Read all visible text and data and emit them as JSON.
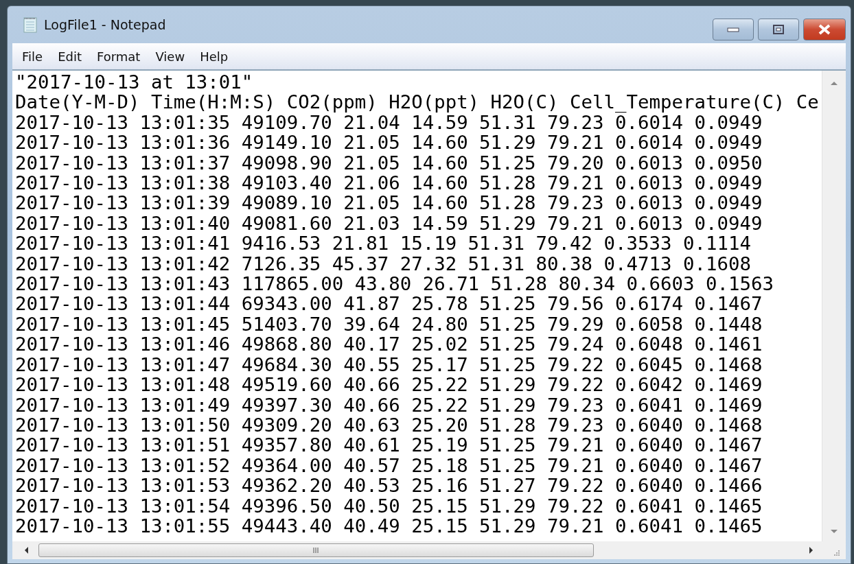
{
  "window": {
    "title": "LogFile1 - Notepad"
  },
  "menu": [
    "File",
    "Edit",
    "Format",
    "View",
    "Help"
  ],
  "lines": [
    "\"2017-10-13 at 13:01\"",
    "Date(Y-M-D) Time(H:M:S) CO2(ppm) H2O(ppt) H2O(C) Cell_Temperature(C) Ce",
    "2017-10-13 13:01:35 49109.70 21.04 14.59 51.31 79.23 0.6014 0.0949",
    "2017-10-13 13:01:36 49149.10 21.05 14.60 51.29 79.21 0.6014 0.0949",
    "2017-10-13 13:01:37 49098.90 21.05 14.60 51.25 79.20 0.6013 0.0950",
    "2017-10-13 13:01:38 49103.40 21.06 14.60 51.28 79.21 0.6013 0.0949",
    "2017-10-13 13:01:39 49089.10 21.05 14.60 51.28 79.23 0.6013 0.0949",
    "2017-10-13 13:01:40 49081.60 21.03 14.59 51.29 79.21 0.6013 0.0949",
    "2017-10-13 13:01:41 9416.53 21.81 15.19 51.31 79.42 0.3533 0.1114",
    "2017-10-13 13:01:42 7126.35 45.37 27.32 51.31 80.38 0.4713 0.1608",
    "2017-10-13 13:01:43 117865.00 43.80 26.71 51.28 80.34 0.6603 0.1563",
    "2017-10-13 13:01:44 69343.00 41.87 25.78 51.25 79.56 0.6174 0.1467",
    "2017-10-13 13:01:45 51403.70 39.64 24.80 51.25 79.29 0.6058 0.1448",
    "2017-10-13 13:01:46 49868.80 40.17 25.02 51.25 79.24 0.6048 0.1461",
    "2017-10-13 13:01:47 49684.30 40.55 25.17 51.25 79.22 0.6045 0.1468",
    "2017-10-13 13:01:48 49519.60 40.66 25.22 51.29 79.22 0.6042 0.1469",
    "2017-10-13 13:01:49 49397.30 40.66 25.22 51.29 79.23 0.6041 0.1469",
    "2017-10-13 13:01:50 49309.20 40.63 25.20 51.28 79.23 0.6040 0.1468",
    "2017-10-13 13:01:51 49357.80 40.61 25.19 51.25 79.21 0.6040 0.1467",
    "2017-10-13 13:01:52 49364.00 40.57 25.18 51.25 79.21 0.6040 0.1467",
    "2017-10-13 13:01:53 49362.20 40.53 25.16 51.27 79.22 0.6040 0.1466",
    "2017-10-13 13:01:54 49396.50 40.50 25.15 51.29 79.22 0.6041 0.1465",
    "2017-10-13 13:01:55 49443.40 40.49 25.15 51.29 79.21 0.6041 0.1465"
  ]
}
